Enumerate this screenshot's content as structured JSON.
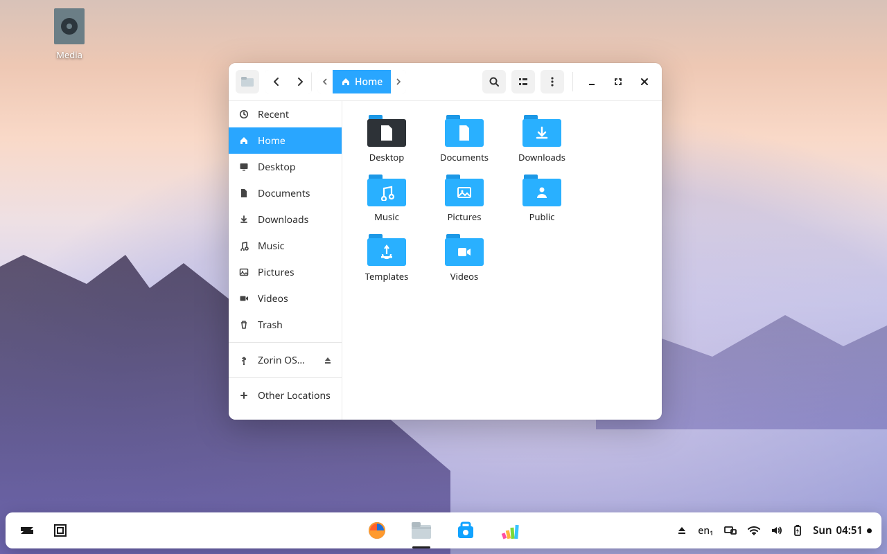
{
  "desktop": {
    "media_label": "Media"
  },
  "window": {
    "path": {
      "home_label": "Home"
    },
    "sidebar": {
      "items": [
        {
          "label": "Recent"
        },
        {
          "label": "Home"
        },
        {
          "label": "Desktop"
        },
        {
          "label": "Documents"
        },
        {
          "label": "Downloads"
        },
        {
          "label": "Music"
        },
        {
          "label": "Pictures"
        },
        {
          "label": "Videos"
        },
        {
          "label": "Trash"
        },
        {
          "label": "Zorin OS…"
        },
        {
          "label": "Other Locations"
        }
      ]
    },
    "content": {
      "items": [
        {
          "label": "Desktop"
        },
        {
          "label": "Documents"
        },
        {
          "label": "Downloads"
        },
        {
          "label": "Music"
        },
        {
          "label": "Pictures"
        },
        {
          "label": "Public"
        },
        {
          "label": "Templates"
        },
        {
          "label": "Videos"
        }
      ]
    }
  },
  "taskbar": {
    "lang": "en₁",
    "clock_day": "Sun",
    "clock_time": "04:51"
  }
}
